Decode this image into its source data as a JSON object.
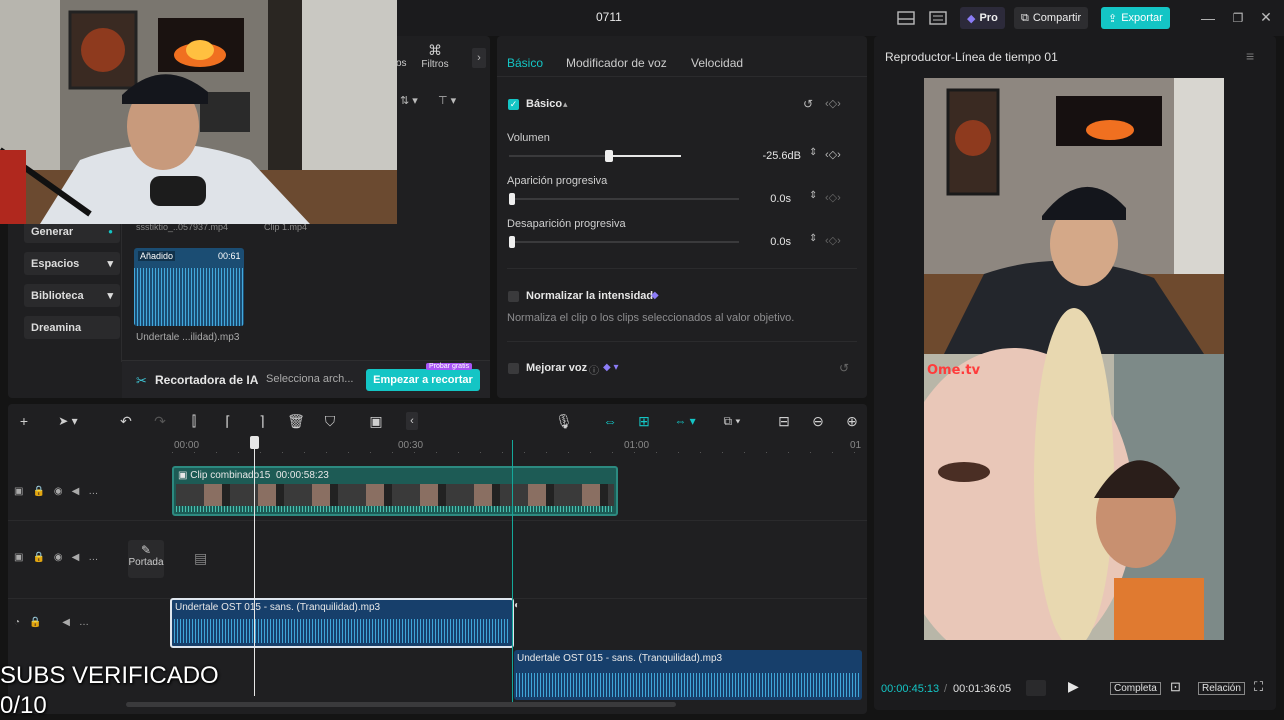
{
  "topbar": {
    "title": "0711",
    "pro_label": "Pro",
    "share_label": "Compartir",
    "export_label": "Exportar",
    "colors": {
      "export": "#14c5c5",
      "pro": "#7b6cf0"
    }
  },
  "media": {
    "tabs_partial": "os",
    "filters_label": "Filtros",
    "sidebar": [
      {
        "label": "Generar"
      },
      {
        "label": "Espacios"
      },
      {
        "label": "Biblioteca"
      },
      {
        "label": "Dreamina"
      }
    ],
    "file_labels_top": [
      "ssstiktio_..057937.mp4",
      "Clip 1.mp4"
    ],
    "asset": {
      "badge": "Añadido",
      "duration": "00:61",
      "name": "Undertale ...ilidad).mp3"
    },
    "ai_cutter_label": "Recortadora de IA",
    "select_file_label": "Selecciona arch...",
    "start_cut_label": "Empezar a recortar",
    "free_trial_badge": "Probar gratis"
  },
  "props": {
    "tabs": [
      "Básico",
      "Modificador de voz",
      "Velocidad"
    ],
    "active_tab": "Básico",
    "section": "Básico",
    "volume": {
      "label": "Volumen",
      "value": "-25.6dB",
      "level": 0.58
    },
    "fade_in": {
      "label": "Aparición progresiva",
      "value": "0.0s",
      "level": 0
    },
    "fade_out": {
      "label": "Desaparición progresiva",
      "value": "0.0s",
      "level": 0
    },
    "normalize": {
      "label": "Normalizar la intensidad",
      "desc": "Normaliza el clip o los clips seleccionados al valor objetivo."
    },
    "enhance": {
      "label": "Mejorar voz"
    }
  },
  "player": {
    "title": "Reproductor-Línea de tiempo 01",
    "current_time": "00:00:45:13",
    "total_time": "00:01:36:05",
    "full_label": "Completa",
    "ratio_label": "Relación",
    "ome_label": "Ome.tv"
  },
  "timeline": {
    "ruler": [
      "00:00",
      "00:30",
      "01:00",
      "01"
    ],
    "cover_label": "Portada",
    "video_clip": {
      "name": "Clip combinado15",
      "duration": "00:00:58:23"
    },
    "audio_clip_1": "Undertale OST 015 - sans. (Tranquilidad).mp3",
    "audio_clip_2": "Undertale OST 015 - sans. (Tranquilidad).mp3"
  },
  "overlay": {
    "subs_line1": "SUBS VERIFICADO",
    "subs_line2": "0/10"
  }
}
